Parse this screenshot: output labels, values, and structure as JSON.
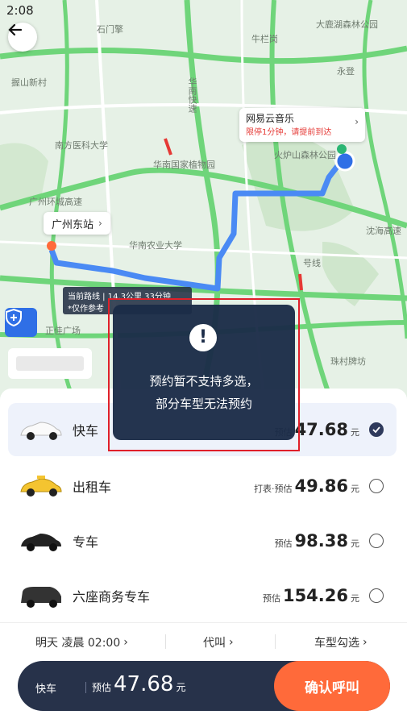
{
  "status": {
    "time": "2:08"
  },
  "map": {
    "labels": [
      "石门擎",
      "牛栏岗",
      "永登",
      "握山新村",
      "南方医科大学",
      "华南国家植物园",
      "火炉山森林公园",
      "华南农业大学",
      "沈海高速",
      "广州环城高速",
      "正佳广场",
      "珠村牌坊",
      "大鹿湖森林公园",
      "华南快速",
      "号线"
    ],
    "destination": {
      "title": "网易云音乐",
      "subtitle": "限停1分钟，请提前到达"
    },
    "start": {
      "title": "广州东站"
    },
    "route_info": {
      "line1": "当前路线 | 14.3公里 33分钟",
      "line2": "*仅作参考"
    }
  },
  "cars": [
    {
      "name": "快车",
      "prefix": "预估",
      "price": "47.68",
      "unit": "元",
      "selected": true,
      "color": "#ffffff"
    },
    {
      "name": "出租车",
      "prefix": "打表·预估",
      "price": "49.86",
      "unit": "元",
      "selected": false,
      "color": "#f4c430"
    },
    {
      "name": "专车",
      "prefix": "预估",
      "price": "98.38",
      "unit": "元",
      "selected": false,
      "color": "#222222"
    },
    {
      "name": "六座商务专车",
      "prefix": "预估",
      "price": "154.26",
      "unit": "元",
      "selected": false,
      "color": "#333333"
    }
  ],
  "options": {
    "time": "明天 凌晨 02:00",
    "proxy": "代叫",
    "car_select": "车型勾选"
  },
  "bottom": {
    "car": "快车",
    "prefix": "预估",
    "price": "47.68",
    "unit": "元",
    "confirm": "确认呼叫"
  },
  "toast": {
    "line1": "预约暂不支持多选，",
    "line2": "部分车型无法预约"
  },
  "colors": {
    "route": "#4a8af4",
    "accent": "#ff6a3a",
    "dark": "#27324a",
    "highlight": "#e0202a"
  }
}
